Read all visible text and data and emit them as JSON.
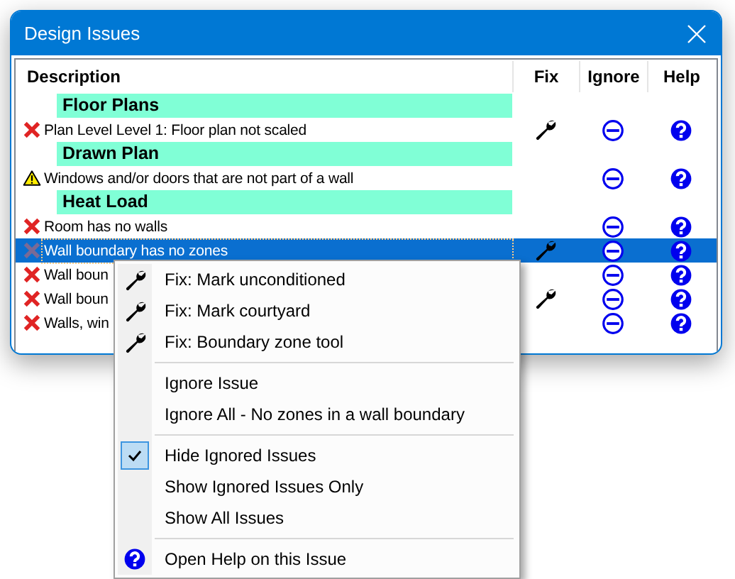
{
  "window": {
    "title": "Design Issues"
  },
  "columns": [
    "Description",
    "Fix",
    "Ignore",
    "Help"
  ],
  "groups": [
    {
      "name": "Floor Plans",
      "rows": [
        {
          "kind": "error",
          "text": "Plan Level Level 1: Floor plan not scaled",
          "fix": true,
          "selected": false
        }
      ]
    },
    {
      "name": "Drawn Plan",
      "rows": [
        {
          "kind": "warning",
          "text": "Windows and/or doors that are not part of a wall",
          "fix": false,
          "selected": false
        }
      ]
    },
    {
      "name": "Heat Load",
      "rows": [
        {
          "kind": "error",
          "text": "Room has no walls",
          "fix": false,
          "selected": false
        },
        {
          "kind": "ignored",
          "text": "Wall boundary has no zones",
          "fix": true,
          "selected": true
        },
        {
          "kind": "error",
          "text": "Wall boun",
          "fix": false,
          "selected": false
        },
        {
          "kind": "error",
          "text": "Wall boun",
          "fix": true,
          "selected": false
        },
        {
          "kind": "error",
          "text": "Walls, win",
          "fix": false,
          "selected": false
        }
      ]
    }
  ],
  "context_menu": {
    "groups": [
      [
        {
          "kind": "fix",
          "label": "Fix: Mark unconditioned"
        },
        {
          "kind": "fix",
          "label": "Fix: Mark courtyard"
        },
        {
          "kind": "fix",
          "label": "Fix: Boundary zone tool"
        }
      ],
      [
        {
          "kind": "plain",
          "label": "Ignore Issue"
        },
        {
          "kind": "plain",
          "label": "Ignore All - No zones in a wall boundary"
        }
      ],
      [
        {
          "kind": "option",
          "label": "Hide Ignored Issues",
          "checked": true
        },
        {
          "kind": "option",
          "label": "Show Ignored Issues Only",
          "checked": false
        },
        {
          "kind": "option",
          "label": "Show All Issues",
          "checked": false
        }
      ],
      [
        {
          "kind": "help",
          "label": "Open Help on this Issue"
        }
      ]
    ]
  }
}
